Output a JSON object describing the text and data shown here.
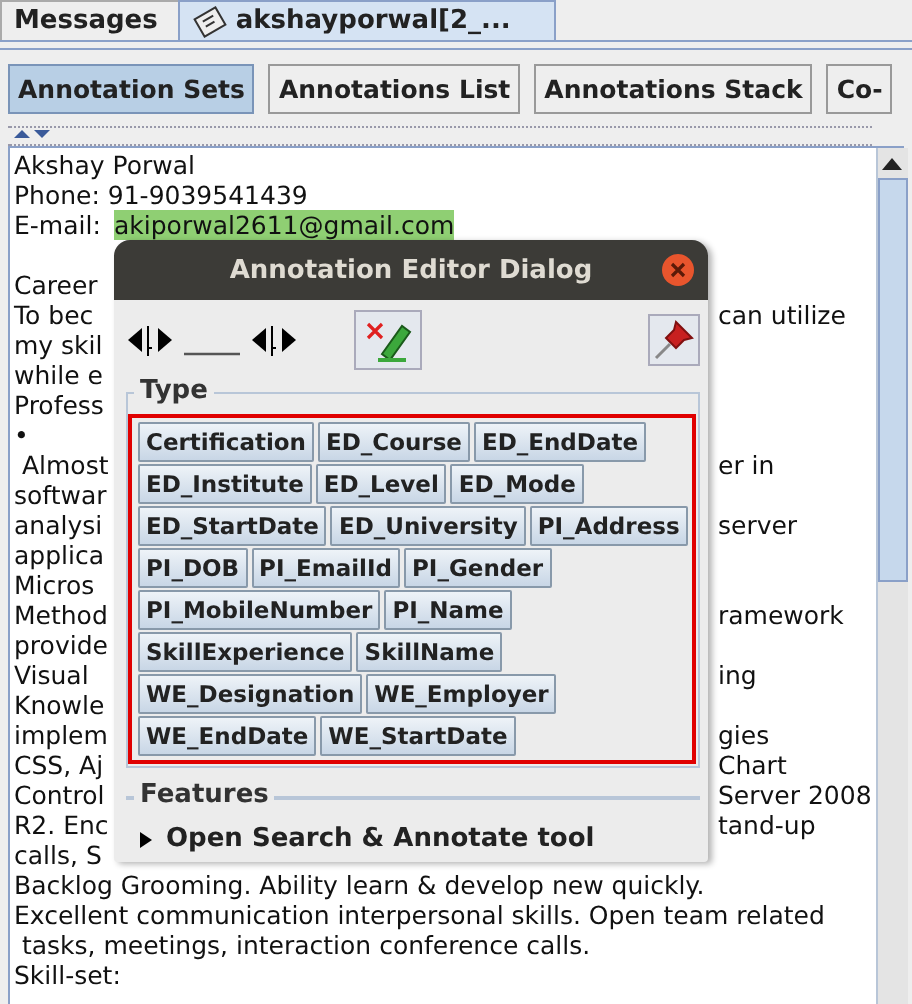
{
  "tabs": [
    {
      "label": "Messages",
      "selected": false,
      "icon": false
    },
    {
      "label": "akshayporwal[2_...",
      "selected": true,
      "icon": true
    }
  ],
  "view_buttons": [
    {
      "label": "Annotation Sets",
      "selected": true
    },
    {
      "label": "Annotations List",
      "selected": false
    },
    {
      "label": "Annotations Stack",
      "selected": false
    },
    {
      "label": "Co-",
      "selected": false
    }
  ],
  "document": {
    "lines": [
      {
        "kind": "text",
        "text": "Akshay Porwal"
      },
      {
        "kind": "text",
        "text": "Phone: 91-9039541439"
      },
      {
        "kind": "text",
        "text": "E-mail: ",
        "highlight": "akiporwal2611@gmail.com"
      },
      {
        "kind": "blank"
      },
      {
        "kind": "text",
        "text": "Career"
      },
      {
        "kind": "text",
        "text": "To bec",
        "tail": "can utilize"
      },
      {
        "kind": "text",
        "text": "my skil"
      },
      {
        "kind": "text",
        "text": "while e"
      },
      {
        "kind": "text",
        "text": "Profess"
      },
      {
        "kind": "text",
        "text": "•"
      },
      {
        "kind": "text",
        "text": " Almost",
        "tail": "er in"
      },
      {
        "kind": "text",
        "text": "softwar"
      },
      {
        "kind": "text",
        "text": "analysi",
        "tail": "server"
      },
      {
        "kind": "text",
        "text": "applica"
      },
      {
        "kind": "text",
        "text": "Micros"
      },
      {
        "kind": "text",
        "text": "Method",
        "tail": "ramework"
      },
      {
        "kind": "text",
        "text": "provide"
      },
      {
        "kind": "text",
        "text": "Visual",
        "tail": "ing"
      },
      {
        "kind": "text",
        "text": "Knowle"
      },
      {
        "kind": "text",
        "text": "implem",
        "tail": "gies"
      },
      {
        "kind": "text",
        "text": "CSS, Aj",
        "tail": "Chart"
      },
      {
        "kind": "text",
        "text": "Control",
        "tail": "Server 2008"
      },
      {
        "kind": "text",
        "text": "R2. Enc",
        "tail": "tand-up"
      },
      {
        "kind": "text",
        "text": "calls, S"
      },
      {
        "kind": "text",
        "text": "Backlog Grooming. Ability learn & develop new quickly."
      },
      {
        "kind": "text",
        "text": "Excellent communication interpersonal skills. Open team related"
      },
      {
        "kind": "text",
        "text": " tasks, meetings, interaction conference calls."
      },
      {
        "kind": "text",
        "text": "Skill-set:"
      }
    ]
  },
  "dialog": {
    "title": "Annotation Editor Dialog",
    "type_label": "Type",
    "types": [
      "Certification",
      "ED_Course",
      "ED_EndDate",
      "ED_Institute",
      "ED_Level",
      "ED_Mode",
      "ED_StartDate",
      "ED_University",
      "PI_Address",
      "PI_DOB",
      "PI_EmailId",
      "PI_Gender",
      "PI_MobileNumber",
      "PI_Name",
      "SkillExperience",
      "SkillName",
      "WE_Designation",
      "WE_Employer",
      "WE_EndDate",
      "WE_StartDate"
    ],
    "features_label": "Features",
    "search_tool": {
      "label": "Open Search & Annotate tool",
      "expanded": false
    }
  }
}
